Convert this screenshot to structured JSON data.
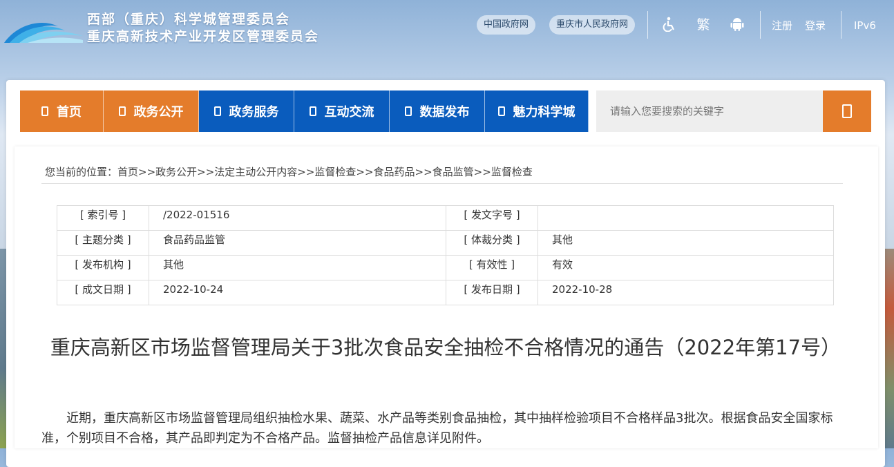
{
  "header": {
    "title_line1": "西部（重庆）科学城管理委员会",
    "title_line2": "重庆高新技术产业开发区管理委员会",
    "links": {
      "gov_cn": "中国政府网",
      "cq_gov": "重庆市人民政府网",
      "traditional": "繁",
      "register": "注册",
      "login": "登录",
      "ipv6": "IPv6"
    },
    "icons": [
      "accessibility-icon",
      "android-icon",
      "document-icon",
      "search-icon",
      "logo"
    ]
  },
  "nav": {
    "items": [
      {
        "label": "首页",
        "color": "#e47c2b"
      },
      {
        "label": "政务公开",
        "color": "#e47c2b"
      },
      {
        "label": "政务服务",
        "color": "#0a5cbd"
      },
      {
        "label": "互动交流",
        "color": "#0a5cbd"
      },
      {
        "label": "数据发布",
        "color": "#0a5cbd"
      },
      {
        "label": "魅力科学城",
        "color": "#0a5cbd"
      }
    ],
    "search_placeholder": "请输入您要搜索的关键字"
  },
  "breadcrumb": "您当前的位置：首页>>政务公开>>法定主动公开内容>>监督检查>>食品药品>>食品监管>>监督检查",
  "meta": {
    "rows": [
      {
        "label1": "[ 索引号 ]",
        "value1": "/2022-01516",
        "label2": "[ 发文字号 ]",
        "value2": ""
      },
      {
        "label1": "[ 主题分类 ]",
        "value1": "食品药品监管",
        "label2": "[ 体裁分类 ]",
        "value2": "其他"
      },
      {
        "label1": "[ 发布机构 ]",
        "value1": "其他",
        "label2": "[ 有效性 ]",
        "value2": "有效"
      },
      {
        "label1": "[ 成文日期 ]",
        "value1": "2022-10-24",
        "label2": "[ 发布日期 ]",
        "value2": "2022-10-28"
      }
    ]
  },
  "article": {
    "title": "重庆高新区市场监督管理局关于3批次食品安全抽检不合格情况的通告（2022年第17号）",
    "body": "近期，重庆高新区市场监督管理局组织抽检水果、蔬菜、水产品等类别食品抽检，其中抽样检验项目不合格样品3批次。根据食品安全国家标准，个别项目不合格，其产品即判定为不合格产品。监督抽检产品信息详见附件。"
  },
  "colors": {
    "accent_orange": "#e47c2b",
    "nav_blue": "#0a5cbd"
  }
}
